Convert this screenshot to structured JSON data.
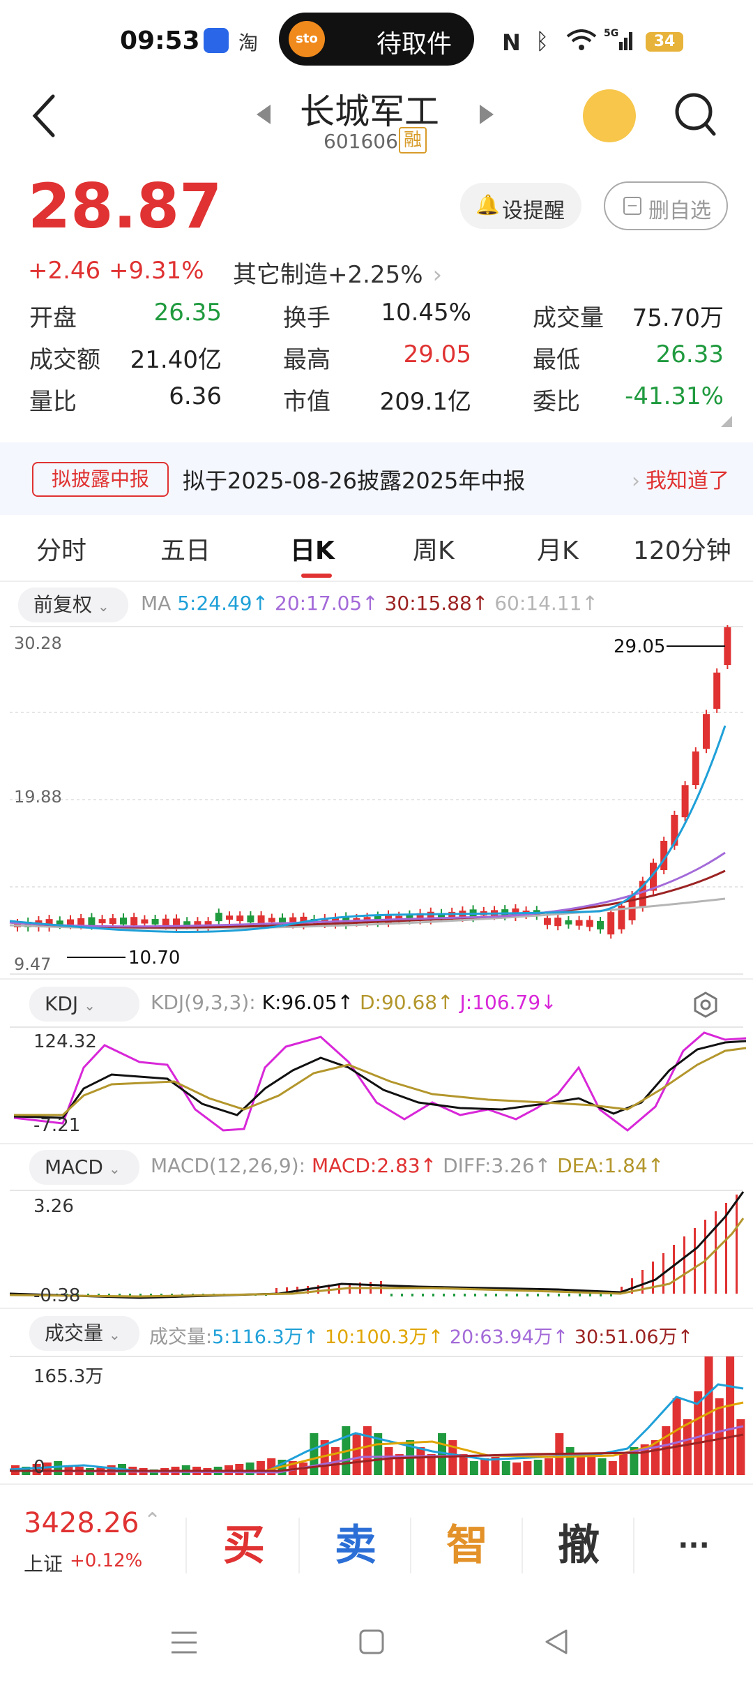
{
  "status": {
    "time": "09:53",
    "app_icon_label": "淘",
    "pill_logo": "sto",
    "pill_text": "待取件",
    "battery": "34"
  },
  "header": {
    "title": "长城军工",
    "code": "601606",
    "margin_badge": "融"
  },
  "quote": {
    "price": "28.87",
    "change": "+2.46",
    "change_pct": "+9.31%",
    "sector": "其它制造",
    "sector_pct": "+2.25%",
    "alert_btn": "设提醒",
    "remove_btn": "删自选",
    "stats": [
      {
        "label": "开盘",
        "value": "26.35",
        "color": "green"
      },
      {
        "label": "换手",
        "value": "10.45%",
        "color": "black"
      },
      {
        "label": "成交量",
        "value": "75.70万",
        "color": "black"
      },
      {
        "label": "成交额",
        "value": "21.40亿",
        "color": "black"
      },
      {
        "label": "最高",
        "value": "29.05",
        "color": "red"
      },
      {
        "label": "最低",
        "value": "26.33",
        "color": "green"
      },
      {
        "label": "量比",
        "value": "6.36",
        "color": "black"
      },
      {
        "label": "市值",
        "value": "209.1亿",
        "color": "black"
      },
      {
        "label": "委比",
        "value": "-41.31%",
        "color": "green"
      }
    ]
  },
  "notice": {
    "badge": "拟披露中报",
    "text": "拟于2025-08-26披露2025年中报",
    "action": "我知道了"
  },
  "tabs": [
    "分时",
    "五日",
    "日K",
    "周K",
    "月K",
    "120分钟"
  ],
  "active_tab": 2,
  "ma_legend": {
    "dropdown": "前复权",
    "label": "MA",
    "ma5": "5:24.49",
    "ma20": "20:17.05",
    "ma30": "30:15.88",
    "ma60": "60:14.11"
  },
  "kline_axis": {
    "top": "30.28",
    "mid": "19.88",
    "bottom": "9.47",
    "high_label": "29.05",
    "low_label": "10.70"
  },
  "kdj": {
    "dropdown": "KDJ",
    "params": "KDJ(9,3,3):",
    "k": "K:96.05",
    "d": "D:90.68",
    "j": "J:106.79",
    "axis_top": "124.32",
    "axis_bottom": "-7.21"
  },
  "macd": {
    "dropdown": "MACD",
    "params": "MACD(12,26,9):",
    "macd": "MACD:2.83",
    "diff": "DIFF:3.26",
    "dea": "DEA:1.84",
    "axis_top": "3.26",
    "axis_bottom": "-0.38"
  },
  "volume": {
    "dropdown": "成交量",
    "prefix": "成交量:",
    "v5": "5:116.3万",
    "v10": "10:100.3万",
    "v20": "20:63.94万",
    "v30": "30:51.06万",
    "axis_top": "165.3万",
    "axis_bottom": "0"
  },
  "bottom": {
    "index_value": "3428.26",
    "index_name": "上证",
    "index_pct": "+0.12%",
    "buy": "买",
    "sell": "卖",
    "smart": "智",
    "cancel": "撤",
    "more": "···"
  },
  "colors": {
    "up": "#e03232",
    "down": "#1f9a3e",
    "ma5": "#1fa0d8",
    "ma20": "#a36ad8",
    "ma30": "#9c2323",
    "ma60": "#b5b5b5",
    "kdj_k": "#111111",
    "kdj_d": "#b3962c",
    "kdj_j": "#d827d8"
  }
}
